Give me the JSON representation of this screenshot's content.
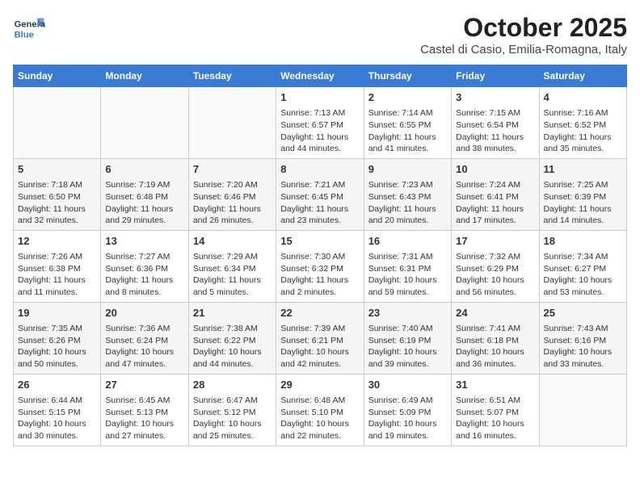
{
  "header": {
    "logo_general": "General",
    "logo_blue": "Blue",
    "month_title": "October 2025",
    "location": "Castel di Casio, Emilia-Romagna, Italy"
  },
  "days_of_week": [
    "Sunday",
    "Monday",
    "Tuesday",
    "Wednesday",
    "Thursday",
    "Friday",
    "Saturday"
  ],
  "weeks": [
    [
      {
        "day": "",
        "info": ""
      },
      {
        "day": "",
        "info": ""
      },
      {
        "day": "",
        "info": ""
      },
      {
        "day": "1",
        "info": "Sunrise: 7:13 AM\nSunset: 6:57 PM\nDaylight: 11 hours\nand 44 minutes."
      },
      {
        "day": "2",
        "info": "Sunrise: 7:14 AM\nSunset: 6:55 PM\nDaylight: 11 hours\nand 41 minutes."
      },
      {
        "day": "3",
        "info": "Sunrise: 7:15 AM\nSunset: 6:54 PM\nDaylight: 11 hours\nand 38 minutes."
      },
      {
        "day": "4",
        "info": "Sunrise: 7:16 AM\nSunset: 6:52 PM\nDaylight: 11 hours\nand 35 minutes."
      }
    ],
    [
      {
        "day": "5",
        "info": "Sunrise: 7:18 AM\nSunset: 6:50 PM\nDaylight: 11 hours\nand 32 minutes."
      },
      {
        "day": "6",
        "info": "Sunrise: 7:19 AM\nSunset: 6:48 PM\nDaylight: 11 hours\nand 29 minutes."
      },
      {
        "day": "7",
        "info": "Sunrise: 7:20 AM\nSunset: 6:46 PM\nDaylight: 11 hours\nand 26 minutes."
      },
      {
        "day": "8",
        "info": "Sunrise: 7:21 AM\nSunset: 6:45 PM\nDaylight: 11 hours\nand 23 minutes."
      },
      {
        "day": "9",
        "info": "Sunrise: 7:23 AM\nSunset: 6:43 PM\nDaylight: 11 hours\nand 20 minutes."
      },
      {
        "day": "10",
        "info": "Sunrise: 7:24 AM\nSunset: 6:41 PM\nDaylight: 11 hours\nand 17 minutes."
      },
      {
        "day": "11",
        "info": "Sunrise: 7:25 AM\nSunset: 6:39 PM\nDaylight: 11 hours\nand 14 minutes."
      }
    ],
    [
      {
        "day": "12",
        "info": "Sunrise: 7:26 AM\nSunset: 6:38 PM\nDaylight: 11 hours\nand 11 minutes."
      },
      {
        "day": "13",
        "info": "Sunrise: 7:27 AM\nSunset: 6:36 PM\nDaylight: 11 hours\nand 8 minutes."
      },
      {
        "day": "14",
        "info": "Sunrise: 7:29 AM\nSunset: 6:34 PM\nDaylight: 11 hours\nand 5 minutes."
      },
      {
        "day": "15",
        "info": "Sunrise: 7:30 AM\nSunset: 6:32 PM\nDaylight: 11 hours\nand 2 minutes."
      },
      {
        "day": "16",
        "info": "Sunrise: 7:31 AM\nSunset: 6:31 PM\nDaylight: 10 hours\nand 59 minutes."
      },
      {
        "day": "17",
        "info": "Sunrise: 7:32 AM\nSunset: 6:29 PM\nDaylight: 10 hours\nand 56 minutes."
      },
      {
        "day": "18",
        "info": "Sunrise: 7:34 AM\nSunset: 6:27 PM\nDaylight: 10 hours\nand 53 minutes."
      }
    ],
    [
      {
        "day": "19",
        "info": "Sunrise: 7:35 AM\nSunset: 6:26 PM\nDaylight: 10 hours\nand 50 minutes."
      },
      {
        "day": "20",
        "info": "Sunrise: 7:36 AM\nSunset: 6:24 PM\nDaylight: 10 hours\nand 47 minutes."
      },
      {
        "day": "21",
        "info": "Sunrise: 7:38 AM\nSunset: 6:22 PM\nDaylight: 10 hours\nand 44 minutes."
      },
      {
        "day": "22",
        "info": "Sunrise: 7:39 AM\nSunset: 6:21 PM\nDaylight: 10 hours\nand 42 minutes."
      },
      {
        "day": "23",
        "info": "Sunrise: 7:40 AM\nSunset: 6:19 PM\nDaylight: 10 hours\nand 39 minutes."
      },
      {
        "day": "24",
        "info": "Sunrise: 7:41 AM\nSunset: 6:18 PM\nDaylight: 10 hours\nand 36 minutes."
      },
      {
        "day": "25",
        "info": "Sunrise: 7:43 AM\nSunset: 6:16 PM\nDaylight: 10 hours\nand 33 minutes."
      }
    ],
    [
      {
        "day": "26",
        "info": "Sunrise: 6:44 AM\nSunset: 5:15 PM\nDaylight: 10 hours\nand 30 minutes."
      },
      {
        "day": "27",
        "info": "Sunrise: 6:45 AM\nSunset: 5:13 PM\nDaylight: 10 hours\nand 27 minutes."
      },
      {
        "day": "28",
        "info": "Sunrise: 6:47 AM\nSunset: 5:12 PM\nDaylight: 10 hours\nand 25 minutes."
      },
      {
        "day": "29",
        "info": "Sunrise: 6:48 AM\nSunset: 5:10 PM\nDaylight: 10 hours\nand 22 minutes."
      },
      {
        "day": "30",
        "info": "Sunrise: 6:49 AM\nSunset: 5:09 PM\nDaylight: 10 hours\nand 19 minutes."
      },
      {
        "day": "31",
        "info": "Sunrise: 6:51 AM\nSunset: 5:07 PM\nDaylight: 10 hours\nand 16 minutes."
      },
      {
        "day": "",
        "info": ""
      }
    ]
  ]
}
